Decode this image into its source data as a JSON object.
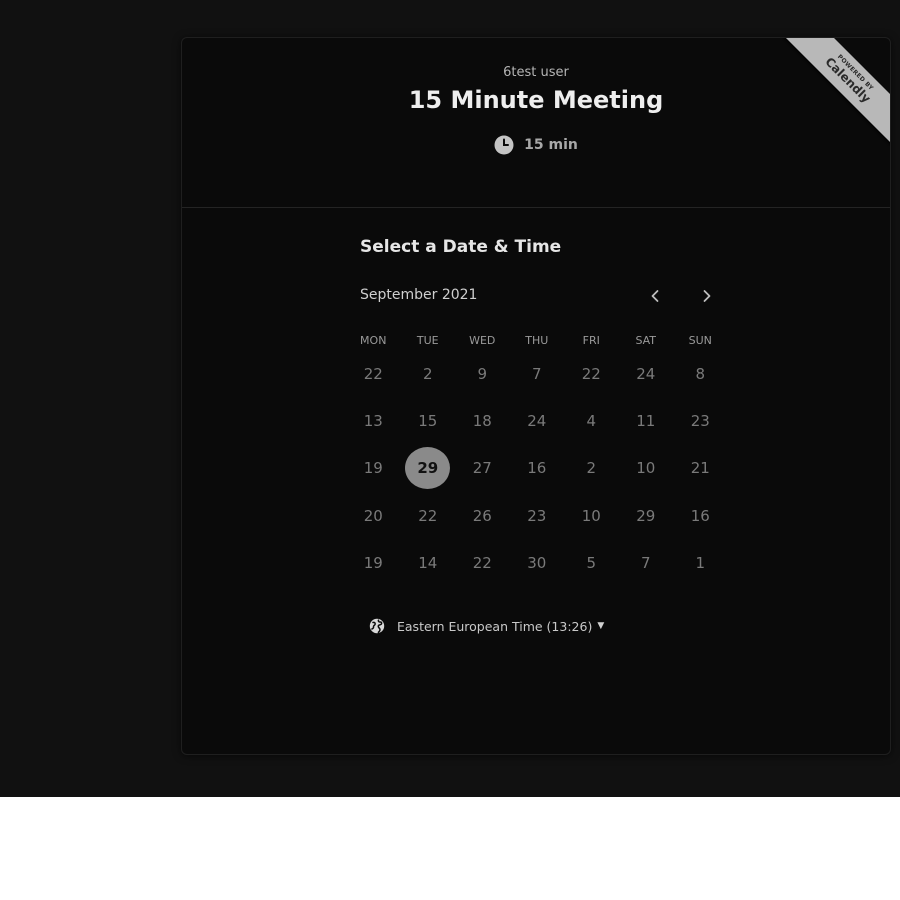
{
  "header": {
    "host_name": "6test user",
    "event_title": "15 Minute Meeting",
    "duration": "15 min"
  },
  "ribbon": {
    "powered_by": "POWERED BY",
    "brand": "Calendly"
  },
  "calendar": {
    "section_title": "Select a Date & Time",
    "month_label": "September 2021",
    "prev_icon": "chevron-left-icon",
    "next_icon": "chevron-right-icon",
    "weekdays": [
      "MON",
      "TUE",
      "WED",
      "THU",
      "FRI",
      "SAT",
      "SUN"
    ],
    "days": [
      "22",
      "2",
      "9",
      "7",
      "22",
      "24",
      "8",
      "13",
      "15",
      "18",
      "24",
      "4",
      "11",
      "23",
      "19",
      "29",
      "27",
      "16",
      "2",
      "10",
      "21",
      "20",
      "22",
      "26",
      "23",
      "10",
      "29",
      "16",
      "19",
      "14",
      "22",
      "30",
      "5",
      "7",
      "1"
    ],
    "selected_day": "29"
  },
  "timezone": {
    "label": "Eastern European Time (13:26)",
    "icon": "globe-icon"
  },
  "colors": {
    "backdrop": "#111111",
    "card": "#0a0a0a",
    "selected_day_bg": "#8a8a8a"
  }
}
